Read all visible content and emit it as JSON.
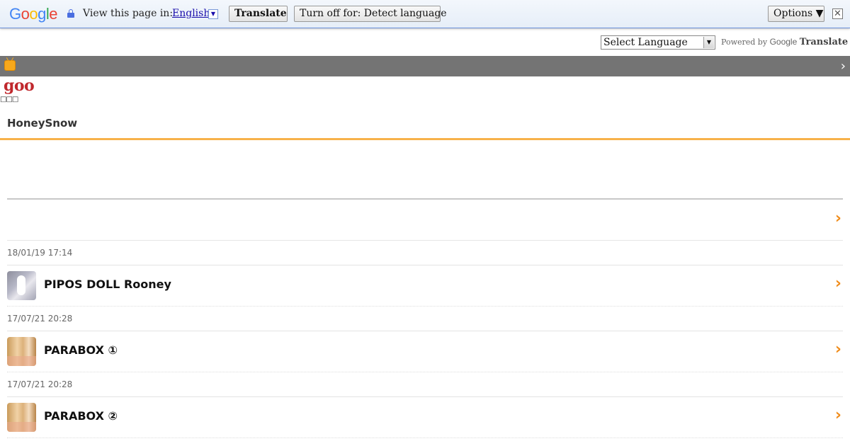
{
  "translate_bar": {
    "logo_letters": [
      {
        "char": "G",
        "color": "#4285f4"
      },
      {
        "char": "o",
        "color": "#ea4335"
      },
      {
        "char": "o",
        "color": "#fbbc05"
      },
      {
        "char": "g",
        "color": "#4285f4"
      },
      {
        "char": "l",
        "color": "#34a853"
      },
      {
        "char": "e",
        "color": "#ea4335"
      }
    ],
    "view_text": "View this page in:",
    "language": "English",
    "language_arrow": "▼",
    "translate_label": "Translate",
    "turn_off_label": "Turn off for: Detect language",
    "options_label": "Options ▼",
    "close_glyph": "✕"
  },
  "language_row": {
    "select_value": "Select Language",
    "select_arrow": "▼",
    "powered_by": "Powered by",
    "powered_google": "Google",
    "powered_translate": "Translate"
  },
  "top_bar": {
    "chevron": "›"
  },
  "site": {
    "logo": "goo",
    "tofu_text": "□□□",
    "blog_title": "HoneySnow"
  },
  "arrow_glyph": "›",
  "entries": [
    {
      "date": "18/01/19 17:14",
      "title": "PIPOS DOLL Rooney",
      "thumb": "rooney"
    },
    {
      "date": "17/07/21 20:28",
      "title": "PARABOX ①",
      "thumb": "parabox"
    },
    {
      "date": "17/07/21 20:28",
      "title": "PARABOX ②",
      "thumb": "parabox"
    }
  ],
  "colors": {
    "accent_orange": "#f08c1a",
    "rule_orange": "#f7b24a",
    "goo_red": "#c0282d",
    "gray_bar": "#747474"
  }
}
